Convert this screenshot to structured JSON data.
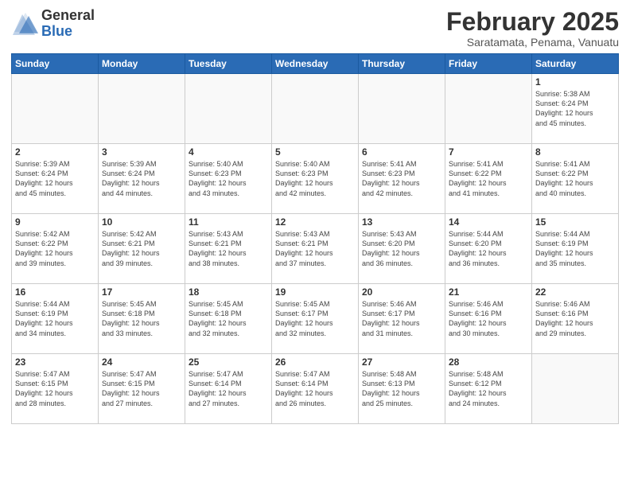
{
  "header": {
    "logo_general": "General",
    "logo_blue": "Blue",
    "month": "February 2025",
    "location": "Saratamata, Penama, Vanuatu"
  },
  "weekdays": [
    "Sunday",
    "Monday",
    "Tuesday",
    "Wednesday",
    "Thursday",
    "Friday",
    "Saturday"
  ],
  "weeks": [
    [
      {
        "day": "",
        "info": ""
      },
      {
        "day": "",
        "info": ""
      },
      {
        "day": "",
        "info": ""
      },
      {
        "day": "",
        "info": ""
      },
      {
        "day": "",
        "info": ""
      },
      {
        "day": "",
        "info": ""
      },
      {
        "day": "1",
        "info": "Sunrise: 5:38 AM\nSunset: 6:24 PM\nDaylight: 12 hours\nand 45 minutes."
      }
    ],
    [
      {
        "day": "2",
        "info": "Sunrise: 5:39 AM\nSunset: 6:24 PM\nDaylight: 12 hours\nand 45 minutes."
      },
      {
        "day": "3",
        "info": "Sunrise: 5:39 AM\nSunset: 6:24 PM\nDaylight: 12 hours\nand 44 minutes."
      },
      {
        "day": "4",
        "info": "Sunrise: 5:40 AM\nSunset: 6:23 PM\nDaylight: 12 hours\nand 43 minutes."
      },
      {
        "day": "5",
        "info": "Sunrise: 5:40 AM\nSunset: 6:23 PM\nDaylight: 12 hours\nand 42 minutes."
      },
      {
        "day": "6",
        "info": "Sunrise: 5:41 AM\nSunset: 6:23 PM\nDaylight: 12 hours\nand 42 minutes."
      },
      {
        "day": "7",
        "info": "Sunrise: 5:41 AM\nSunset: 6:22 PM\nDaylight: 12 hours\nand 41 minutes."
      },
      {
        "day": "8",
        "info": "Sunrise: 5:41 AM\nSunset: 6:22 PM\nDaylight: 12 hours\nand 40 minutes."
      }
    ],
    [
      {
        "day": "9",
        "info": "Sunrise: 5:42 AM\nSunset: 6:22 PM\nDaylight: 12 hours\nand 39 minutes."
      },
      {
        "day": "10",
        "info": "Sunrise: 5:42 AM\nSunset: 6:21 PM\nDaylight: 12 hours\nand 39 minutes."
      },
      {
        "day": "11",
        "info": "Sunrise: 5:43 AM\nSunset: 6:21 PM\nDaylight: 12 hours\nand 38 minutes."
      },
      {
        "day": "12",
        "info": "Sunrise: 5:43 AM\nSunset: 6:21 PM\nDaylight: 12 hours\nand 37 minutes."
      },
      {
        "day": "13",
        "info": "Sunrise: 5:43 AM\nSunset: 6:20 PM\nDaylight: 12 hours\nand 36 minutes."
      },
      {
        "day": "14",
        "info": "Sunrise: 5:44 AM\nSunset: 6:20 PM\nDaylight: 12 hours\nand 36 minutes."
      },
      {
        "day": "15",
        "info": "Sunrise: 5:44 AM\nSunset: 6:19 PM\nDaylight: 12 hours\nand 35 minutes."
      }
    ],
    [
      {
        "day": "16",
        "info": "Sunrise: 5:44 AM\nSunset: 6:19 PM\nDaylight: 12 hours\nand 34 minutes."
      },
      {
        "day": "17",
        "info": "Sunrise: 5:45 AM\nSunset: 6:18 PM\nDaylight: 12 hours\nand 33 minutes."
      },
      {
        "day": "18",
        "info": "Sunrise: 5:45 AM\nSunset: 6:18 PM\nDaylight: 12 hours\nand 32 minutes."
      },
      {
        "day": "19",
        "info": "Sunrise: 5:45 AM\nSunset: 6:17 PM\nDaylight: 12 hours\nand 32 minutes."
      },
      {
        "day": "20",
        "info": "Sunrise: 5:46 AM\nSunset: 6:17 PM\nDaylight: 12 hours\nand 31 minutes."
      },
      {
        "day": "21",
        "info": "Sunrise: 5:46 AM\nSunset: 6:16 PM\nDaylight: 12 hours\nand 30 minutes."
      },
      {
        "day": "22",
        "info": "Sunrise: 5:46 AM\nSunset: 6:16 PM\nDaylight: 12 hours\nand 29 minutes."
      }
    ],
    [
      {
        "day": "23",
        "info": "Sunrise: 5:47 AM\nSunset: 6:15 PM\nDaylight: 12 hours\nand 28 minutes."
      },
      {
        "day": "24",
        "info": "Sunrise: 5:47 AM\nSunset: 6:15 PM\nDaylight: 12 hours\nand 27 minutes."
      },
      {
        "day": "25",
        "info": "Sunrise: 5:47 AM\nSunset: 6:14 PM\nDaylight: 12 hours\nand 27 minutes."
      },
      {
        "day": "26",
        "info": "Sunrise: 5:47 AM\nSunset: 6:14 PM\nDaylight: 12 hours\nand 26 minutes."
      },
      {
        "day": "27",
        "info": "Sunrise: 5:48 AM\nSunset: 6:13 PM\nDaylight: 12 hours\nand 25 minutes."
      },
      {
        "day": "28",
        "info": "Sunrise: 5:48 AM\nSunset: 6:12 PM\nDaylight: 12 hours\nand 24 minutes."
      },
      {
        "day": "",
        "info": ""
      }
    ]
  ]
}
